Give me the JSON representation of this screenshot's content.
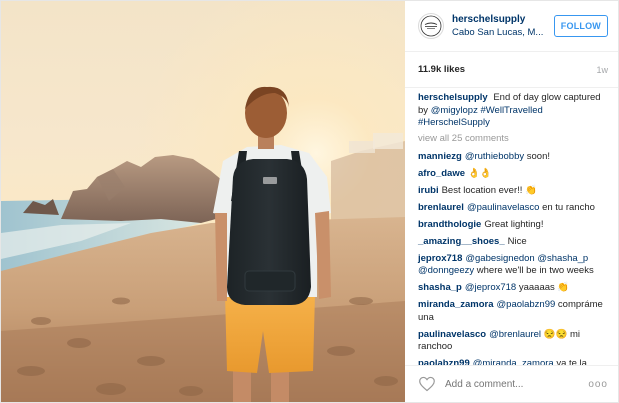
{
  "post": {
    "username": "herschelsupply",
    "location": "Cabo San Lucas, M...",
    "follow_label": "FOLLOW",
    "likes": "11.9k likes",
    "time": "1w",
    "avatar_text": [
      "Herschel",
      "Supply",
      "Co."
    ],
    "caption": {
      "username": "herschelsupply",
      "parts": [
        {
          "text": "End of day glow captured by ",
          "type": "text"
        },
        {
          "text": "@migylopz",
          "type": "mention"
        },
        {
          "text": " ",
          "type": "text"
        },
        {
          "text": "#WellTravelled",
          "type": "mention"
        },
        {
          "text": " ",
          "type": "text"
        },
        {
          "text": "#HerschelSupply",
          "type": "mention"
        }
      ]
    },
    "view_all": "view all 25 comments",
    "comments": [
      {
        "username": "manniezg",
        "parts": [
          {
            "text": "@ruthiebobby",
            "type": "mention"
          },
          {
            "text": " soon!",
            "type": "text"
          }
        ]
      },
      {
        "username": "afro_dawe",
        "parts": [
          {
            "text": "👌👌",
            "type": "text"
          }
        ]
      },
      {
        "username": "irubi",
        "parts": [
          {
            "text": "Best location ever!! 👏",
            "type": "text"
          }
        ]
      },
      {
        "username": "brenlaurel",
        "parts": [
          {
            "text": "@paulinavelasco",
            "type": "mention"
          },
          {
            "text": " en tu rancho",
            "type": "text"
          }
        ]
      },
      {
        "username": "brandthologie",
        "parts": [
          {
            "text": "Great lighting!",
            "type": "text"
          }
        ]
      },
      {
        "username": "_amazing__shoes_",
        "parts": [
          {
            "text": "Nice",
            "type": "text"
          }
        ]
      },
      {
        "username": "jeprox718",
        "parts": [
          {
            "text": "@gabesignedon",
            "type": "mention"
          },
          {
            "text": " ",
            "type": "text"
          },
          {
            "text": "@shasha_p",
            "type": "mention"
          },
          {
            "text": " ",
            "type": "text"
          },
          {
            "text": "@donngeezy",
            "type": "mention"
          },
          {
            "text": " where we'll be in two weeks",
            "type": "text"
          }
        ]
      },
      {
        "username": "shasha_p",
        "parts": [
          {
            "text": "@jeprox718",
            "type": "mention"
          },
          {
            "text": " yaaaaas 👏",
            "type": "text"
          }
        ]
      },
      {
        "username": "miranda_zamora",
        "parts": [
          {
            "text": "@paolabzn99",
            "type": "mention"
          },
          {
            "text": " compráme una",
            "type": "text"
          }
        ]
      },
      {
        "username": "paulinavelasco",
        "parts": [
          {
            "text": "@brenlaurel",
            "type": "mention"
          },
          {
            "text": " 😒😒 mi ranchoo",
            "type": "text"
          }
        ]
      },
      {
        "username": "paolabzn99",
        "parts": [
          {
            "text": "@miranda_zamora",
            "type": "mention"
          },
          {
            "text": " ya te la",
            "type": "text"
          }
        ]
      }
    ],
    "add_comment_placeholder": "Add a comment...",
    "more_label": "ooo"
  },
  "colors": {
    "link": "#003569",
    "follow_blue": "#3897f0",
    "muted": "#999999"
  },
  "icons": [
    "herschel-logo-icon",
    "heart-icon",
    "more-options-icon"
  ]
}
